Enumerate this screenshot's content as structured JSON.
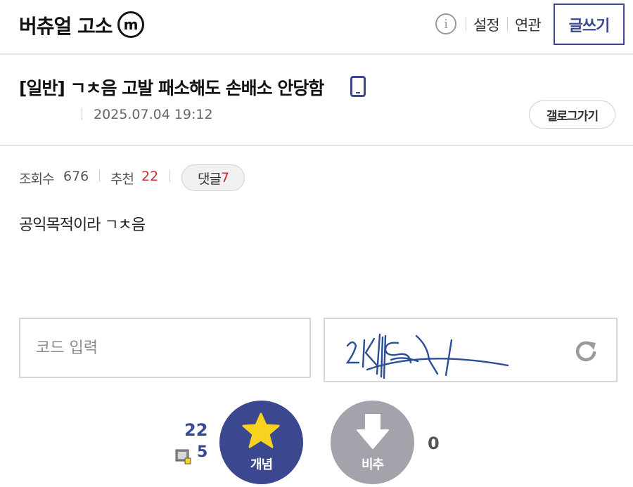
{
  "header": {
    "gallery_title": "버츄얼 고소",
    "minor_badge": "m",
    "info_icon": "info-icon",
    "links": [
      "설정",
      "연관"
    ],
    "write_button": "글쓰기"
  },
  "post": {
    "title": "[일반] ㄱㅊ음 고발 패소해도 손배소 안당함",
    "device_icon": "mobile-phone-icon",
    "date": "2025.07.04 19:12",
    "gallery_button": "갤로그가기",
    "stats": {
      "views_label": "조회수",
      "views": "676",
      "recommend_label": "추천",
      "recommend": "22",
      "comments_label": "댓글",
      "comments": "7"
    },
    "body": "공익목적이라 ㄱㅊ음"
  },
  "captcha": {
    "placeholder": "코드 입력",
    "refresh_icon": "refresh-icon"
  },
  "votes": {
    "up_count": "22",
    "fix_count": "5",
    "up_label": "개념",
    "down_label": "비추",
    "down_count": "0"
  },
  "colors": {
    "accent": "#3b4890",
    "downvote": "#a3a3ac",
    "star": "#f8d21f",
    "highlight_red": "#c23030"
  }
}
